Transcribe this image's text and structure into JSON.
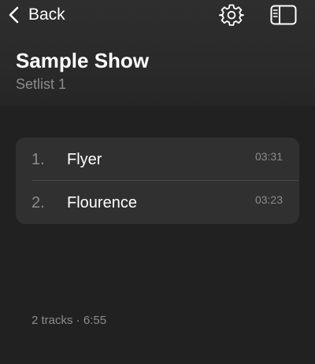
{
  "header": {
    "back_label": "Back",
    "title": "Sample Show",
    "subtitle": "Setlist 1",
    "icons": {
      "back": "chevron-left-icon",
      "settings": "gear-icon",
      "sidebar": "sidebar-toggle-icon"
    }
  },
  "tracks": [
    {
      "number": "1.",
      "title": "Flyer",
      "duration": "03:31"
    },
    {
      "number": "2.",
      "title": "Flourence",
      "duration": "03:23"
    }
  ],
  "footer": {
    "summary": "2 tracks · 6:55"
  },
  "colors": {
    "background": "#212121",
    "header_background": "#2b2b2b",
    "card_background": "#303030",
    "primary_text": "#ffffff",
    "secondary_text": "#8c8c8c"
  }
}
